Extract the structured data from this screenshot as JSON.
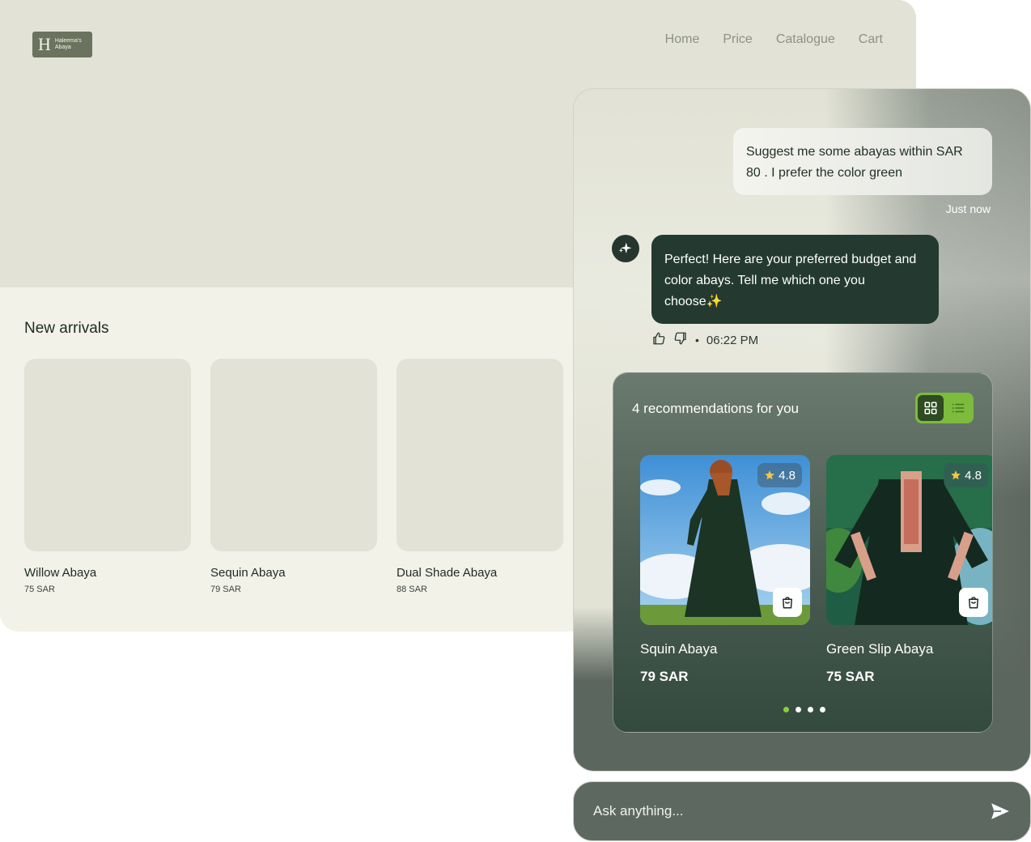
{
  "site": {
    "logo": {
      "initial": "H",
      "line1": "Haleema's",
      "line2": "Abaya"
    },
    "nav": [
      "Home",
      "Price",
      "Catalogue",
      "Cart"
    ],
    "section_title": "New arrivals",
    "products": [
      {
        "name": "Willow Abaya",
        "price": "75 SAR"
      },
      {
        "name": "Sequin Abaya",
        "price": "79 SAR"
      },
      {
        "name": "Dual Shade Abaya",
        "price": "88 SAR"
      }
    ]
  },
  "chat": {
    "user_message": "Suggest me some abayas within SAR 80 . I prefer the color green",
    "user_time": "Just now",
    "ai_message": "Perfect! Here are your preferred budget and color abays. Tell me which one you choose✨",
    "ai_time": "06:22 PM",
    "recommendations": {
      "title": "4 recommendations for you",
      "items": [
        {
          "name": "Squin Abaya",
          "price": "79 SAR",
          "rating": "4.8"
        },
        {
          "name": "Green Slip Abaya",
          "price": "75 SAR",
          "rating": "4.8"
        }
      ],
      "pages": 4,
      "active_page": 1
    },
    "input": {
      "placeholder": "Ask anything..."
    }
  },
  "colors": {
    "accent_green": "#8bcf3a",
    "dark_green": "#243a31",
    "panel_gray": "#5d6860"
  },
  "icons": [
    "sparkle-icon",
    "thumbs-up-icon",
    "thumbs-down-icon",
    "grid-view-icon",
    "list-view-icon",
    "star-icon",
    "shopping-bag-icon",
    "send-icon"
  ]
}
